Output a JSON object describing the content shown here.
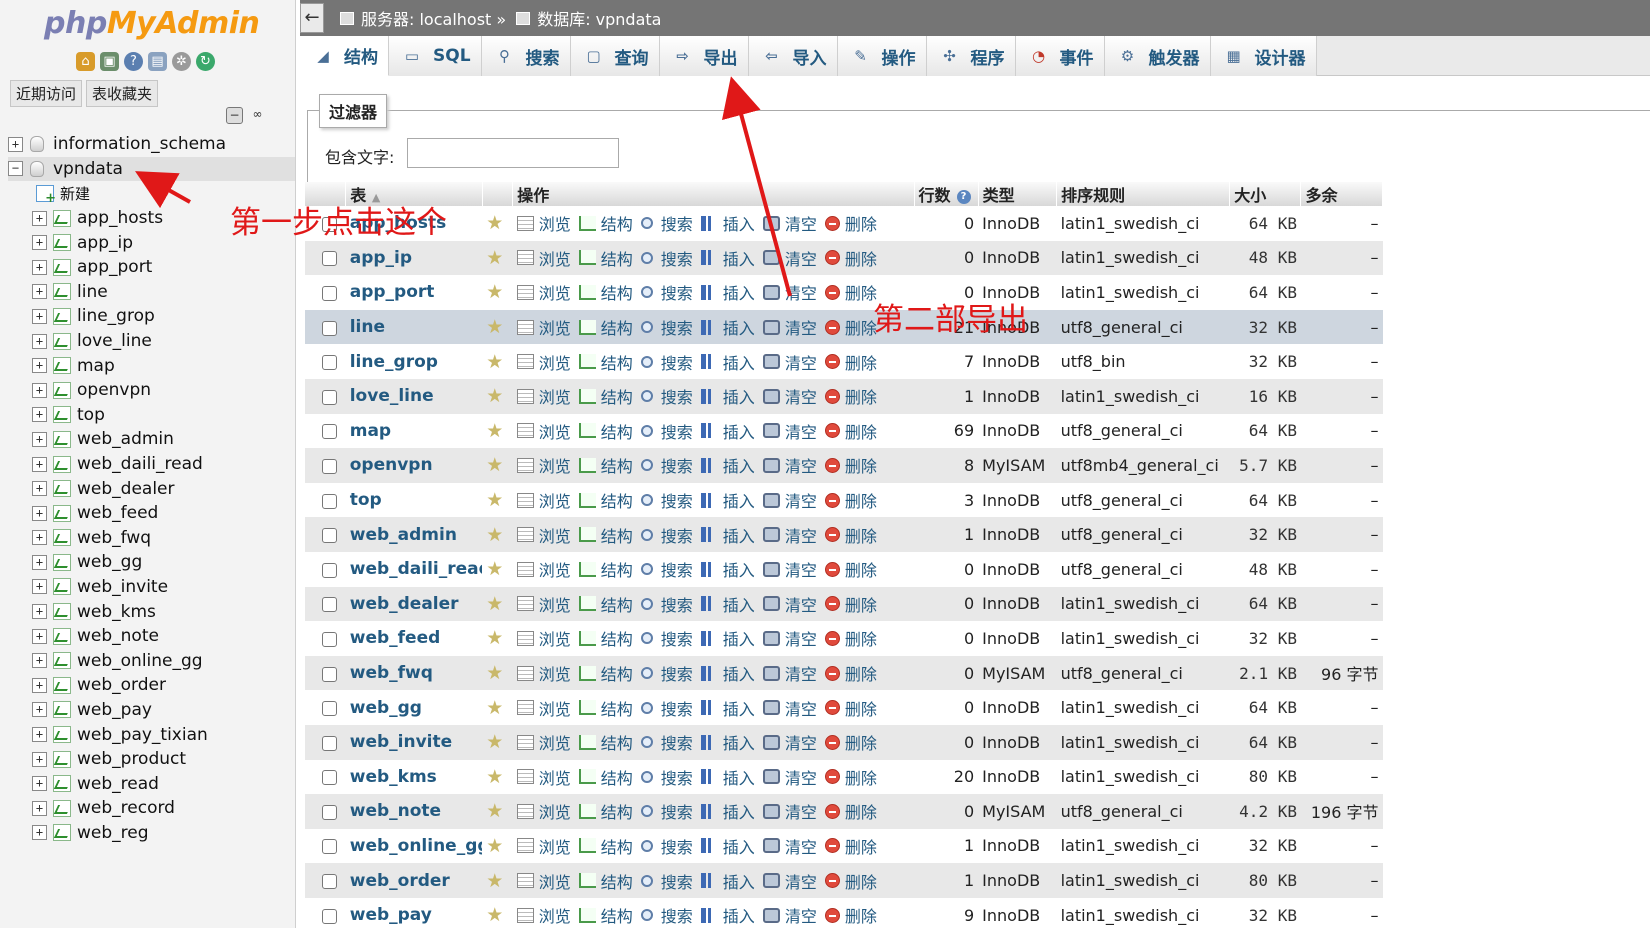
{
  "nav": {
    "logo": {
      "php": "php",
      "my": "My",
      "admin": "Admin"
    },
    "tabs": [
      "近期访问",
      "表收藏夹"
    ],
    "databases": [
      {
        "name": "information_schema",
        "expanded": false
      },
      {
        "name": "vpndata",
        "expanded": true
      }
    ],
    "new_label": "新建",
    "tables": [
      "app_hosts",
      "app_ip",
      "app_port",
      "line",
      "line_grop",
      "love_line",
      "map",
      "openvpn",
      "top",
      "web_admin",
      "web_daili_read",
      "web_dealer",
      "web_feed",
      "web_fwq",
      "web_gg",
      "web_invite",
      "web_kms",
      "web_note",
      "web_online_gg",
      "web_order",
      "web_pay",
      "web_pay_tixian",
      "web_product",
      "web_read",
      "web_record",
      "web_reg"
    ]
  },
  "topbar": {
    "back": "←",
    "server": "服务器: localhost »",
    "database": "数据库: vpndata"
  },
  "menu": [
    "结构",
    "SQL",
    "搜索",
    "查询",
    "导出",
    "导入",
    "操作",
    "程序",
    "事件",
    "触发器",
    "设计器"
  ],
  "filter": {
    "legend": "过滤器",
    "label": "包含文字:",
    "value": ""
  },
  "table": {
    "headers": {
      "table": "表",
      "actions": "操作",
      "rows": "行数",
      "type": "类型",
      "collation": "排序规则",
      "size": "大小",
      "overhead": "多余"
    },
    "actions": {
      "browse": "浏览",
      "structure": "结构",
      "search": "搜索",
      "insert": "插入",
      "empty": "清空",
      "drop": "删除"
    },
    "rows": [
      {
        "name": "app_hosts",
        "rows": "0",
        "type": "InnoDB",
        "collation": "latin1_swedish_ci",
        "size": "64 KB",
        "overhead": "–"
      },
      {
        "name": "app_ip",
        "rows": "0",
        "type": "InnoDB",
        "collation": "latin1_swedish_ci",
        "size": "48 KB",
        "overhead": "–"
      },
      {
        "name": "app_port",
        "rows": "0",
        "type": "InnoDB",
        "collation": "latin1_swedish_ci",
        "size": "64 KB",
        "overhead": "–"
      },
      {
        "name": "line",
        "rows": "21",
        "type": "InnoDB",
        "collation": "utf8_general_ci",
        "size": "32 KB",
        "overhead": "–"
      },
      {
        "name": "line_grop",
        "rows": "7",
        "type": "InnoDB",
        "collation": "utf8_bin",
        "size": "32 KB",
        "overhead": "–"
      },
      {
        "name": "love_line",
        "rows": "1",
        "type": "InnoDB",
        "collation": "latin1_swedish_ci",
        "size": "16 KB",
        "overhead": "–"
      },
      {
        "name": "map",
        "rows": "69",
        "type": "InnoDB",
        "collation": "utf8_general_ci",
        "size": "64 KB",
        "overhead": "–"
      },
      {
        "name": "openvpn",
        "rows": "8",
        "type": "MyISAM",
        "collation": "utf8mb4_general_ci",
        "size": "5.7 KB",
        "overhead": "–"
      },
      {
        "name": "top",
        "rows": "3",
        "type": "InnoDB",
        "collation": "utf8_general_ci",
        "size": "64 KB",
        "overhead": "–"
      },
      {
        "name": "web_admin",
        "rows": "1",
        "type": "InnoDB",
        "collation": "utf8_general_ci",
        "size": "32 KB",
        "overhead": "–"
      },
      {
        "name": "web_daili_read",
        "rows": "0",
        "type": "InnoDB",
        "collation": "utf8_general_ci",
        "size": "48 KB",
        "overhead": "–"
      },
      {
        "name": "web_dealer",
        "rows": "0",
        "type": "InnoDB",
        "collation": "latin1_swedish_ci",
        "size": "64 KB",
        "overhead": "–"
      },
      {
        "name": "web_feed",
        "rows": "0",
        "type": "InnoDB",
        "collation": "latin1_swedish_ci",
        "size": "32 KB",
        "overhead": "–"
      },
      {
        "name": "web_fwq",
        "rows": "0",
        "type": "MyISAM",
        "collation": "utf8_general_ci",
        "size": "2.1 KB",
        "overhead": "96 字节"
      },
      {
        "name": "web_gg",
        "rows": "0",
        "type": "InnoDB",
        "collation": "latin1_swedish_ci",
        "size": "64 KB",
        "overhead": "–"
      },
      {
        "name": "web_invite",
        "rows": "0",
        "type": "InnoDB",
        "collation": "latin1_swedish_ci",
        "size": "64 KB",
        "overhead": "–"
      },
      {
        "name": "web_kms",
        "rows": "20",
        "type": "InnoDB",
        "collation": "latin1_swedish_ci",
        "size": "80 KB",
        "overhead": "–"
      },
      {
        "name": "web_note",
        "rows": "0",
        "type": "MyISAM",
        "collation": "utf8_general_ci",
        "size": "4.2 KB",
        "overhead": "196 字节"
      },
      {
        "name": "web_online_gg",
        "rows": "1",
        "type": "InnoDB",
        "collation": "latin1_swedish_ci",
        "size": "32 KB",
        "overhead": "–"
      },
      {
        "name": "web_order",
        "rows": "1",
        "type": "InnoDB",
        "collation": "latin1_swedish_ci",
        "size": "80 KB",
        "overhead": "–"
      },
      {
        "name": "web_pay",
        "rows": "9",
        "type": "InnoDB",
        "collation": "latin1_swedish_ci",
        "size": "32 KB",
        "overhead": "–"
      }
    ]
  },
  "annotations": {
    "step1": "第一步点击这个",
    "step2": "第二部导出",
    "color": "#e01818"
  }
}
